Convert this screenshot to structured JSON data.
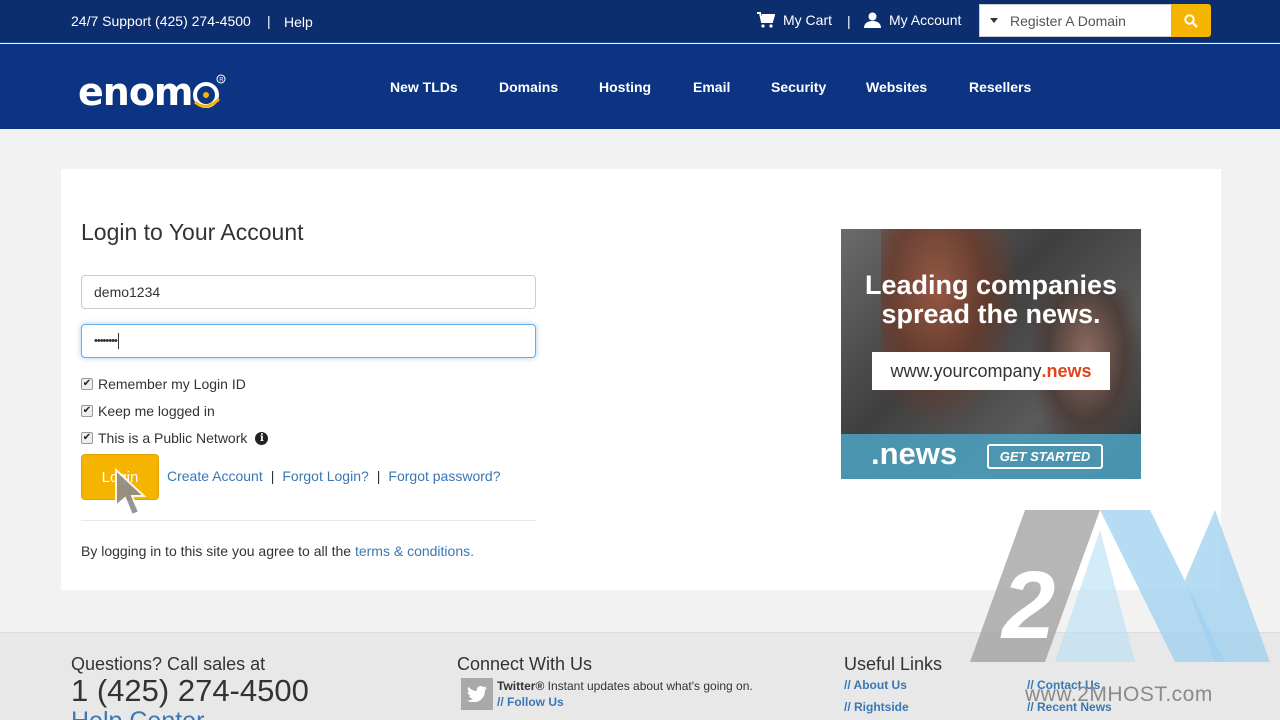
{
  "topbar": {
    "support": "24/7 Support (425) 274-4500",
    "help": "Help",
    "cart": "My Cart",
    "account": "My Account",
    "search_placeholder": "Register A Domain"
  },
  "brand": {
    "logo": "enom"
  },
  "nav": [
    "New TLDs",
    "Domains",
    "Hosting",
    "Email",
    "Security",
    "Websites",
    "Resellers"
  ],
  "login": {
    "title": "Login to Your Account",
    "username": "demo1234",
    "password_mask": "••••••••",
    "remember": "Remember my Login ID",
    "keep": "Keep me logged in",
    "public": "This is a Public Network",
    "button": "Login",
    "create": "Create Account",
    "forgot_login": "Forgot Login?",
    "forgot_password": "Forgot password?",
    "agree_prefix": "By logging in to this site you agree to all the ",
    "agree_link": "terms & conditions",
    "agree_suffix": "."
  },
  "ad": {
    "headline1": "Leading companies",
    "headline2": "spread the news.",
    "url_prefix": "www.yourcompany",
    "url_tld": ".news",
    "tld": ".news",
    "cta": "GET STARTED"
  },
  "footer": {
    "questions": "Questions? Call sales at",
    "phone": "1 (425) 274-4500",
    "help_center": "Help Center",
    "connect": "Connect With Us",
    "twitter_label": "Twitter®",
    "twitter_desc": " Instant updates about what's going on.",
    "follow": "// Follow Us",
    "useful": "Useful Links",
    "links": [
      "// About Us",
      "// Rightside",
      "// Contact Us",
      "// Recent News"
    ]
  },
  "watermark": {
    "text": "www.2MHOST.com",
    "digit": "2"
  },
  "colors": {
    "topbar": "#0d2e6e",
    "navbar": "#0d3483",
    "accent": "#f5b400",
    "link": "#3a77b5"
  }
}
